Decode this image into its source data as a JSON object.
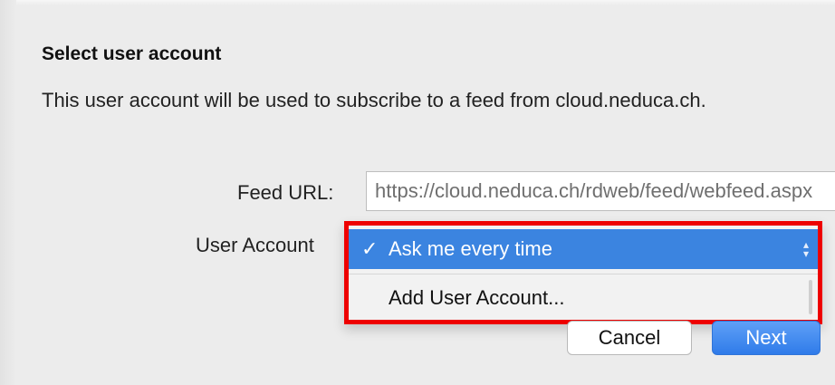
{
  "dialog": {
    "title": "Select user account",
    "description": "This user account will be used to subscribe to a feed from cloud.neduca.ch."
  },
  "form": {
    "feed_url_label": "Feed URL:",
    "feed_url_value": "https://cloud.neduca.ch/rdweb/feed/webfeed.aspx",
    "user_account_label": "User Account"
  },
  "dropdown": {
    "selected_check": "✓",
    "items": [
      {
        "label": "Ask me every time",
        "selected": true
      },
      {
        "label": "Add User Account...",
        "selected": false
      }
    ],
    "highlight_color": "#3b84e0",
    "annotation_border_color": "#ee0000"
  },
  "buttons": {
    "cancel_label": "Cancel",
    "next_label": "Next"
  }
}
